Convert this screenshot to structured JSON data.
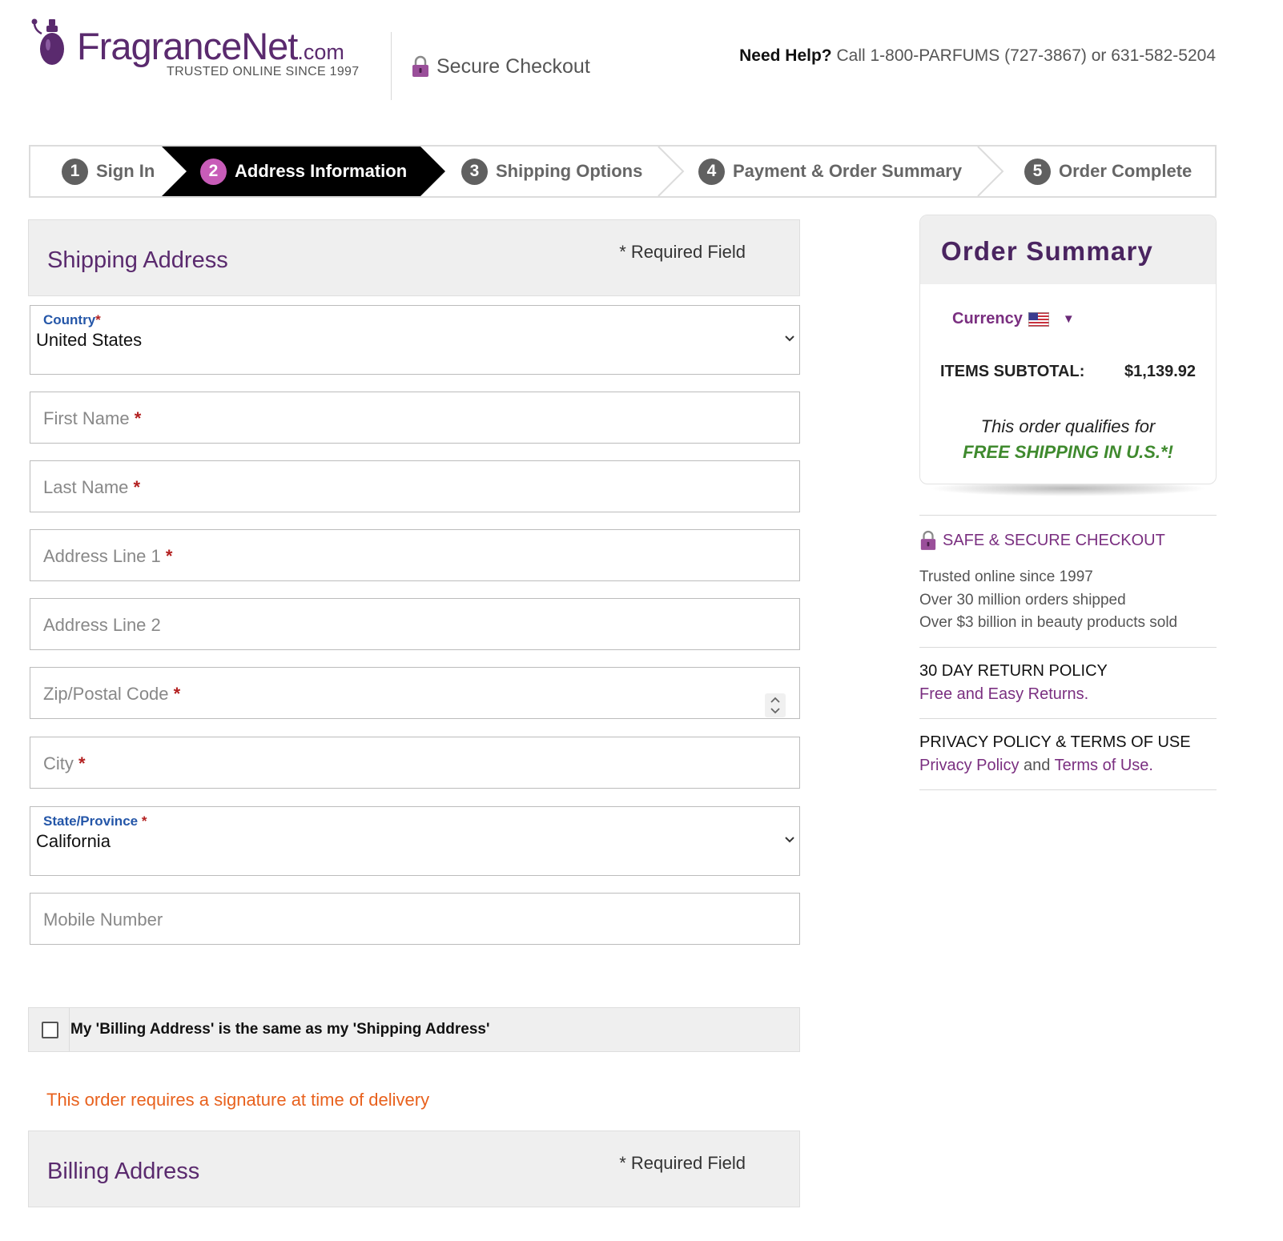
{
  "header": {
    "brand": "FragranceNet",
    "brand_suffix": ".com",
    "tagline": "TRUSTED ONLINE SINCE 1997",
    "secure_checkout": "Secure Checkout",
    "help_label": "Need Help?",
    "help_text": "Call 1-800-PARFUMS (727-3867) or 631-582-5204"
  },
  "steps": [
    {
      "num": "1",
      "label": "Sign In",
      "active": false
    },
    {
      "num": "2",
      "label": "Address Information",
      "active": true
    },
    {
      "num": "3",
      "label": "Shipping Options",
      "active": false
    },
    {
      "num": "4",
      "label": "Payment & Order Summary",
      "active": false
    },
    {
      "num": "5",
      "label": "Order Complete",
      "active": false
    }
  ],
  "shipping": {
    "title": "Shipping Address",
    "required_note": "* Required Field",
    "country_label": "Country",
    "country_value": "United States",
    "first_name_placeholder": "First Name",
    "last_name_placeholder": "Last Name",
    "address1_placeholder": "Address Line 1",
    "address2_placeholder": "Address Line 2",
    "zip_placeholder": "Zip/Postal Code",
    "city_placeholder": "City",
    "state_label": "State/Province",
    "state_value": "California",
    "mobile_placeholder": "Mobile Number",
    "required_mark": "*"
  },
  "billing_same_label": "My 'Billing Address' is the same as my 'Shipping Address'",
  "billing_same_checked": false,
  "signature_note": "This order requires a signature at time of delivery",
  "billing": {
    "title": "Billing Address",
    "required_note": "* Required Field"
  },
  "summary": {
    "title": "Order Summary",
    "currency_label": "Currency",
    "subtotal_label": "ITEMS SUBTOTAL:",
    "subtotal_value": "$1,139.92",
    "qualifies_text": "This order qualifies for",
    "free_shipping_text": "FREE SHIPPING IN U.S.*!"
  },
  "trust": {
    "secure_title": "SAFE & SECURE CHECKOUT",
    "lines": [
      "Trusted online since 1997",
      "Over 30 million orders shipped",
      "Over $3 billion in beauty products sold"
    ],
    "return_title": "30 DAY RETURN POLICY",
    "return_link": "Free and Easy Returns.",
    "privacy_title": "PRIVACY POLICY & TERMS OF USE",
    "privacy_link": "Privacy Policy",
    "privacy_and": " and ",
    "terms_link": "Terms of Use",
    "privacy_end": "."
  },
  "colors": {
    "brand_purple": "#5a2a6e",
    "link_purple": "#7a2f80",
    "active_step_bg": "#000000",
    "active_step_badge": "#c85cb8",
    "signature_orange": "#e8611d",
    "free_shipping_green": "#3f8a2e",
    "label_blue": "#2456a8"
  },
  "icons": [
    "perfume-bottle-logo",
    "padlock-icon",
    "us-flag-icon",
    "chevron-down-icon",
    "checkbox"
  ]
}
